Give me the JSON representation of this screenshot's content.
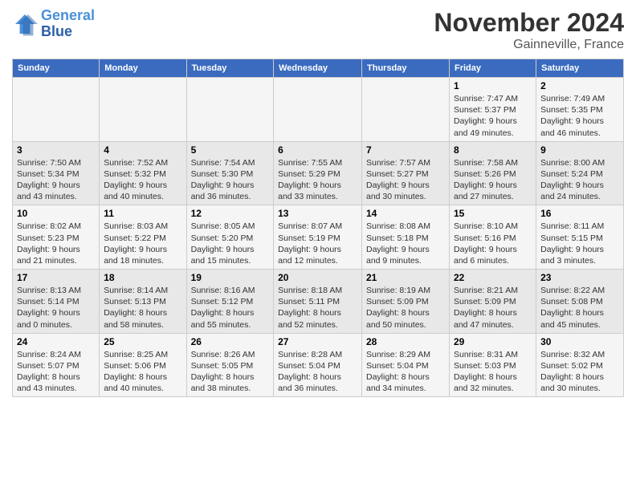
{
  "header": {
    "logo_line1": "General",
    "logo_line2": "Blue",
    "title": "November 2024",
    "location": "Gainneville, France"
  },
  "columns": [
    "Sunday",
    "Monday",
    "Tuesday",
    "Wednesday",
    "Thursday",
    "Friday",
    "Saturday"
  ],
  "weeks": [
    [
      {
        "day": "",
        "info": ""
      },
      {
        "day": "",
        "info": ""
      },
      {
        "day": "",
        "info": ""
      },
      {
        "day": "",
        "info": ""
      },
      {
        "day": "",
        "info": ""
      },
      {
        "day": "1",
        "info": "Sunrise: 7:47 AM\nSunset: 5:37 PM\nDaylight: 9 hours\nand 49 minutes."
      },
      {
        "day": "2",
        "info": "Sunrise: 7:49 AM\nSunset: 5:35 PM\nDaylight: 9 hours\nand 46 minutes."
      }
    ],
    [
      {
        "day": "3",
        "info": "Sunrise: 7:50 AM\nSunset: 5:34 PM\nDaylight: 9 hours\nand 43 minutes."
      },
      {
        "day": "4",
        "info": "Sunrise: 7:52 AM\nSunset: 5:32 PM\nDaylight: 9 hours\nand 40 minutes."
      },
      {
        "day": "5",
        "info": "Sunrise: 7:54 AM\nSunset: 5:30 PM\nDaylight: 9 hours\nand 36 minutes."
      },
      {
        "day": "6",
        "info": "Sunrise: 7:55 AM\nSunset: 5:29 PM\nDaylight: 9 hours\nand 33 minutes."
      },
      {
        "day": "7",
        "info": "Sunrise: 7:57 AM\nSunset: 5:27 PM\nDaylight: 9 hours\nand 30 minutes."
      },
      {
        "day": "8",
        "info": "Sunrise: 7:58 AM\nSunset: 5:26 PM\nDaylight: 9 hours\nand 27 minutes."
      },
      {
        "day": "9",
        "info": "Sunrise: 8:00 AM\nSunset: 5:24 PM\nDaylight: 9 hours\nand 24 minutes."
      }
    ],
    [
      {
        "day": "10",
        "info": "Sunrise: 8:02 AM\nSunset: 5:23 PM\nDaylight: 9 hours\nand 21 minutes."
      },
      {
        "day": "11",
        "info": "Sunrise: 8:03 AM\nSunset: 5:22 PM\nDaylight: 9 hours\nand 18 minutes."
      },
      {
        "day": "12",
        "info": "Sunrise: 8:05 AM\nSunset: 5:20 PM\nDaylight: 9 hours\nand 15 minutes."
      },
      {
        "day": "13",
        "info": "Sunrise: 8:07 AM\nSunset: 5:19 PM\nDaylight: 9 hours\nand 12 minutes."
      },
      {
        "day": "14",
        "info": "Sunrise: 8:08 AM\nSunset: 5:18 PM\nDaylight: 9 hours\nand 9 minutes."
      },
      {
        "day": "15",
        "info": "Sunrise: 8:10 AM\nSunset: 5:16 PM\nDaylight: 9 hours\nand 6 minutes."
      },
      {
        "day": "16",
        "info": "Sunrise: 8:11 AM\nSunset: 5:15 PM\nDaylight: 9 hours\nand 3 minutes."
      }
    ],
    [
      {
        "day": "17",
        "info": "Sunrise: 8:13 AM\nSunset: 5:14 PM\nDaylight: 9 hours\nand 0 minutes."
      },
      {
        "day": "18",
        "info": "Sunrise: 8:14 AM\nSunset: 5:13 PM\nDaylight: 8 hours\nand 58 minutes."
      },
      {
        "day": "19",
        "info": "Sunrise: 8:16 AM\nSunset: 5:12 PM\nDaylight: 8 hours\nand 55 minutes."
      },
      {
        "day": "20",
        "info": "Sunrise: 8:18 AM\nSunset: 5:11 PM\nDaylight: 8 hours\nand 52 minutes."
      },
      {
        "day": "21",
        "info": "Sunrise: 8:19 AM\nSunset: 5:09 PM\nDaylight: 8 hours\nand 50 minutes."
      },
      {
        "day": "22",
        "info": "Sunrise: 8:21 AM\nSunset: 5:09 PM\nDaylight: 8 hours\nand 47 minutes."
      },
      {
        "day": "23",
        "info": "Sunrise: 8:22 AM\nSunset: 5:08 PM\nDaylight: 8 hours\nand 45 minutes."
      }
    ],
    [
      {
        "day": "24",
        "info": "Sunrise: 8:24 AM\nSunset: 5:07 PM\nDaylight: 8 hours\nand 43 minutes."
      },
      {
        "day": "25",
        "info": "Sunrise: 8:25 AM\nSunset: 5:06 PM\nDaylight: 8 hours\nand 40 minutes."
      },
      {
        "day": "26",
        "info": "Sunrise: 8:26 AM\nSunset: 5:05 PM\nDaylight: 8 hours\nand 38 minutes."
      },
      {
        "day": "27",
        "info": "Sunrise: 8:28 AM\nSunset: 5:04 PM\nDaylight: 8 hours\nand 36 minutes."
      },
      {
        "day": "28",
        "info": "Sunrise: 8:29 AM\nSunset: 5:04 PM\nDaylight: 8 hours\nand 34 minutes."
      },
      {
        "day": "29",
        "info": "Sunrise: 8:31 AM\nSunset: 5:03 PM\nDaylight: 8 hours\nand 32 minutes."
      },
      {
        "day": "30",
        "info": "Sunrise: 8:32 AM\nSunset: 5:02 PM\nDaylight: 8 hours\nand 30 minutes."
      }
    ]
  ]
}
